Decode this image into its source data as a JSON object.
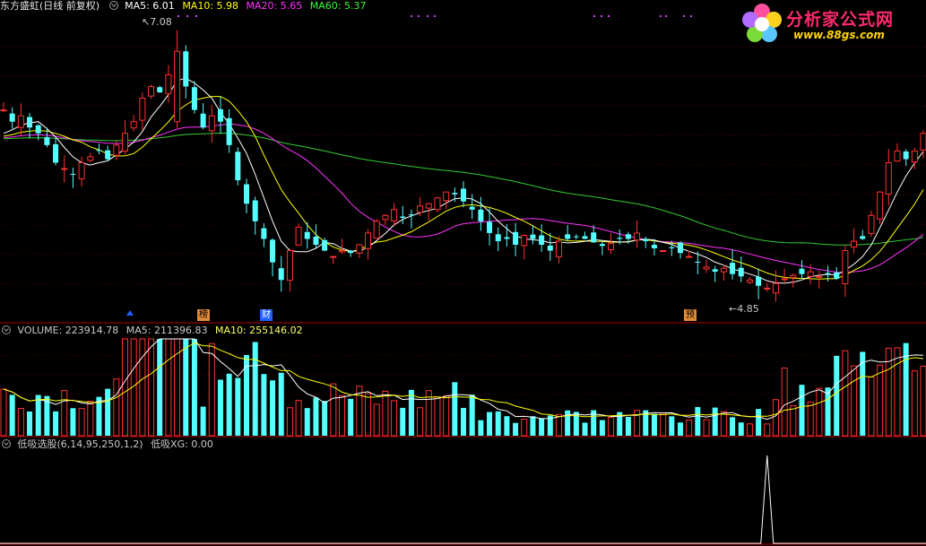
{
  "header": {
    "title": "东方盛虹(日线 前复权)",
    "indicators": [
      {
        "label": "MA5: 6.01",
        "color": "#ffffff"
      },
      {
        "label": "MA10: 5.98",
        "color": "#ffff00"
      },
      {
        "label": "MA20: 5.65",
        "color": "#ff33ff"
      },
      {
        "label": "MA60: 5.37",
        "color": "#33ff33"
      }
    ]
  },
  "volume_header": {
    "label": "VOLUME: 223914.78",
    "ma5": "MA5: 211396.83",
    "ma10": "MA10: 255146.02"
  },
  "indicator_header": {
    "label": "低吸选股(6,14,95,250,1,2)",
    "value": "低吸XG: 0.00"
  },
  "logo": {
    "brand": "分析家公式网",
    "url": "www.88gs.com"
  },
  "annotations": {
    "high": "7.08",
    "low": "4.85"
  },
  "markers": [
    {
      "text": "榜",
      "style": "orange"
    },
    {
      "text": "财",
      "style": "blue"
    },
    {
      "text": "预",
      "style": "orange"
    }
  ],
  "colors": {
    "up": "#ff3232",
    "down": "#54ffff",
    "ma5": "#ffffff",
    "ma10": "#ffff00",
    "ma20": "#ff33ff",
    "ma60": "#33cc33",
    "grid": "#8b0000"
  },
  "chart_data": [
    {
      "type": "candlestick",
      "title": "东方盛虹(日线 前复权)",
      "ylim": [
        4.6,
        7.2
      ],
      "annotations": {
        "high": 7.08,
        "low": 4.85
      },
      "closes": [
        6.4,
        6.3,
        6.35,
        6.25,
        6.2,
        6.1,
        5.95,
        5.9,
        5.85,
        5.95,
        6.0,
        6.05,
        5.98,
        6.1,
        6.2,
        6.3,
        6.5,
        6.6,
        6.55,
        6.7,
        6.9,
        6.6,
        6.4,
        6.25,
        6.35,
        6.3,
        6.1,
        5.8,
        5.6,
        5.45,
        5.3,
        5.1,
        4.95,
        5.2,
        5.4,
        5.3,
        5.25,
        5.2,
        5.15,
        5.2,
        5.18,
        5.25,
        5.35,
        5.45,
        5.5,
        5.55,
        5.48,
        5.5,
        5.58,
        5.6,
        5.65,
        5.7,
        5.68,
        5.62,
        5.55,
        5.45,
        5.35,
        5.28,
        5.3,
        5.25,
        5.33,
        5.3,
        5.25,
        5.2,
        5.28,
        5.3,
        5.32,
        5.3,
        5.27,
        5.24,
        5.26,
        5.3,
        5.3,
        5.35,
        5.28,
        5.22,
        5.2,
        5.22,
        5.18,
        5.15,
        5.1,
        5.06,
        5.02,
        5.05,
        5.0,
        4.98,
        4.95,
        4.9,
        4.88,
        4.92,
        4.96,
        4.99,
        5.0,
        5.02,
        4.98,
        5.0,
        4.96,
        5.2,
        5.28,
        5.3,
        5.5,
        5.7,
        5.95,
        6.05,
        5.98,
        6.05,
        6.2
      ]
    },
    {
      "type": "bar",
      "title": "VOLUME",
      "values": [
        223914.78
      ],
      "ma": {
        "MA5": 211396.83,
        "MA10": 255146.02
      }
    },
    {
      "type": "line",
      "title": "低吸选股(6,14,95,250,1,2)",
      "series": [
        {
          "name": "低吸XG",
          "values": [
            0.0
          ]
        }
      ]
    }
  ]
}
